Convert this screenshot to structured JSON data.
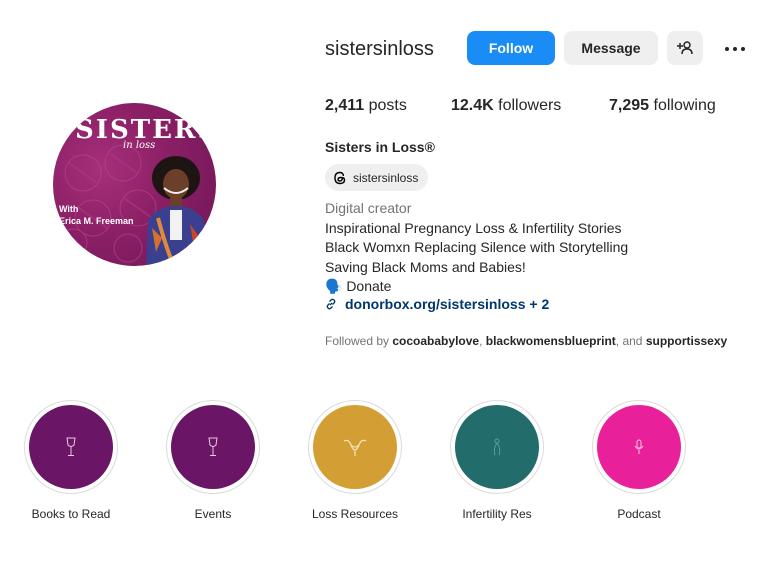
{
  "profile": {
    "username": "sistersinloss",
    "full_name": "Sisters in Loss®",
    "avatar": {
      "brand": "SISTERS",
      "brand_sub": "in loss",
      "with": "With",
      "host": "Erica M. Freeman"
    }
  },
  "actions": {
    "follow": "Follow",
    "message": "Message",
    "add_user_icon": "add-user-icon",
    "more_icon": "more-options-icon"
  },
  "stats": {
    "posts_value": "2,411",
    "posts_label": "posts",
    "followers_value": "12.4K",
    "followers_label": "followers",
    "following_value": "7,295",
    "following_label": "following"
  },
  "threads": {
    "handle": "sistersinloss",
    "icon": "threads-icon"
  },
  "bio": {
    "category": "Digital creator",
    "lines": [
      "Inspirational Pregnancy Loss & Infertility Stories",
      "Black Womxn Replacing Silence with Storytelling",
      "Saving Black Moms and Babies!"
    ],
    "donate": "🗣️ Donate",
    "link": "donorbox.org/sistersinloss",
    "link_more": "+ 2"
  },
  "followed_by": {
    "prefix": "Followed by",
    "user1": "cocoababylove",
    "user2": "blackwomensblueprint",
    "and": "and",
    "user3": "supportissexy"
  },
  "highlights": [
    {
      "label": "Books to Read",
      "color": "#6a1565",
      "icon": "wine-glass-icon"
    },
    {
      "label": "Events",
      "color": "#6a1565",
      "icon": "wine-glass-icon"
    },
    {
      "label": "Loss Resources",
      "color": "#d39e33",
      "icon": "uterus-icon"
    },
    {
      "label": "Infertility Res",
      "color": "#236c6c",
      "icon": "figure-icon"
    },
    {
      "label": "Podcast",
      "color": "#e8219a",
      "icon": "microphone-icon"
    }
  ]
}
